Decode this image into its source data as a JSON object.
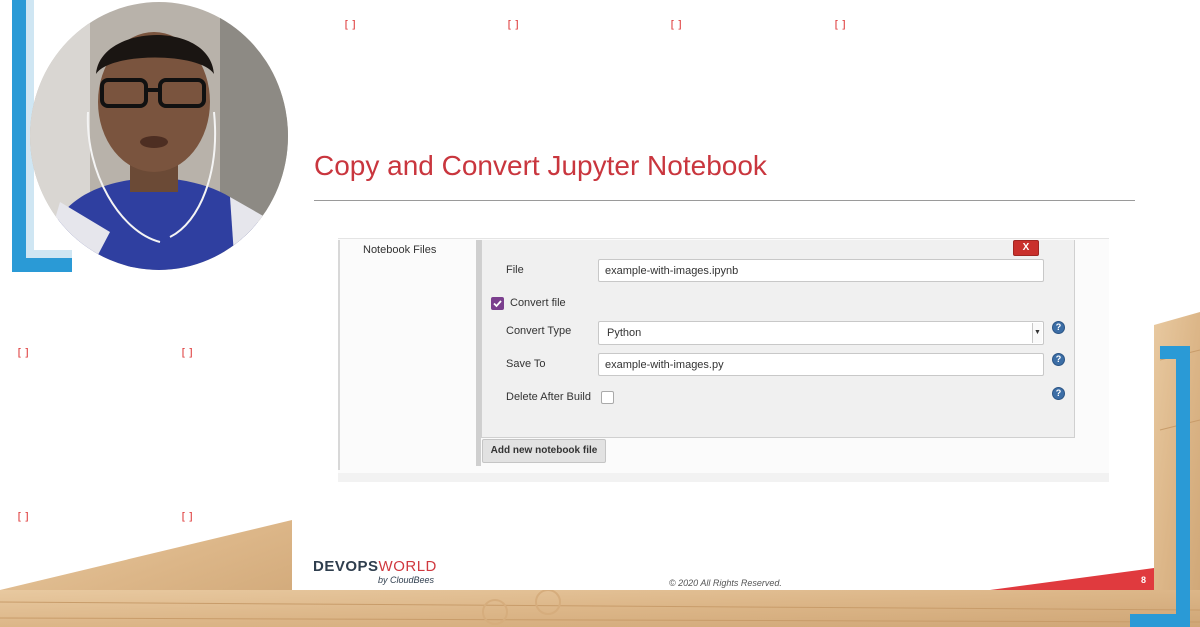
{
  "slide": {
    "title": "Copy and Convert Jupyter Notebook",
    "placeholder_glyph": "[]",
    "page_number": "8",
    "copyright": "© 2020 All Rights Reserved.",
    "logo": {
      "devops": "DEVOPS",
      "world": "WORLD",
      "by": "by CloudBees"
    }
  },
  "form": {
    "section_label": "Notebook Files",
    "delete_label": "X",
    "file": {
      "label": "File",
      "value": "example-with-images.ipynb"
    },
    "convert": {
      "label": "Convert file",
      "checked": true
    },
    "convert_type": {
      "label": "Convert Type",
      "value": "Python"
    },
    "save_to": {
      "label": "Save To",
      "value": "example-with-images.py"
    },
    "delete_after_build": {
      "label": "Delete After Build",
      "checked": false
    },
    "help_glyph": "?",
    "add_button": "Add new notebook file"
  },
  "colors": {
    "accent_red": "#c9363e",
    "bracket_blue": "#2a9ad6",
    "checkbox_purple": "#7b3f8e"
  },
  "icons": [
    "webcam-presenter",
    "help-icon",
    "checkbox-checked-icon",
    "checkbox-empty-icon",
    "dropdown-arrow-icon"
  ]
}
